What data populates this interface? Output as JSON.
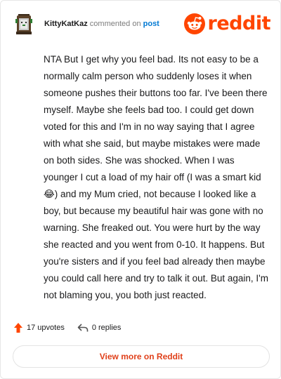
{
  "comment": {
    "username": "KittyKatKaz",
    "action_text": "commented on",
    "post_link": "post",
    "body": "NTA But I get why you feel bad. Its not easy to be a normally calm person who suddenly loses it when someone pushes their buttons too far. I've been there myself. Maybe she feels bad too. I could get down voted for this and I'm in no way saying that I agree with what she said, but maybe mistakes were made on both sides. She was shocked. When I was younger I cut a load of my hair off (I was a smart kid 😂) and my Mum cried, not because I looked like a boy, but because my beautiful hair was gone with no warning. She freaked out. You were hurt by the way she reacted and you went from 0-10. It happens. But you're sisters and if you feel bad already then maybe you could call here and try to talk it out. But again, I'm not blaming you, you both just reacted."
  },
  "brand": {
    "logo_text": "reddit",
    "color": "#ff4500"
  },
  "stats": {
    "upvotes_label": "17 upvotes",
    "replies_label": "0 replies"
  },
  "footer": {
    "view_more_label": "View more on Reddit"
  },
  "icons": {
    "avatar": "user-avatar-icon",
    "logo": "reddit-snoo-icon",
    "upvote": "upvote-arrow-icon",
    "reply": "reply-arrow-icon"
  }
}
